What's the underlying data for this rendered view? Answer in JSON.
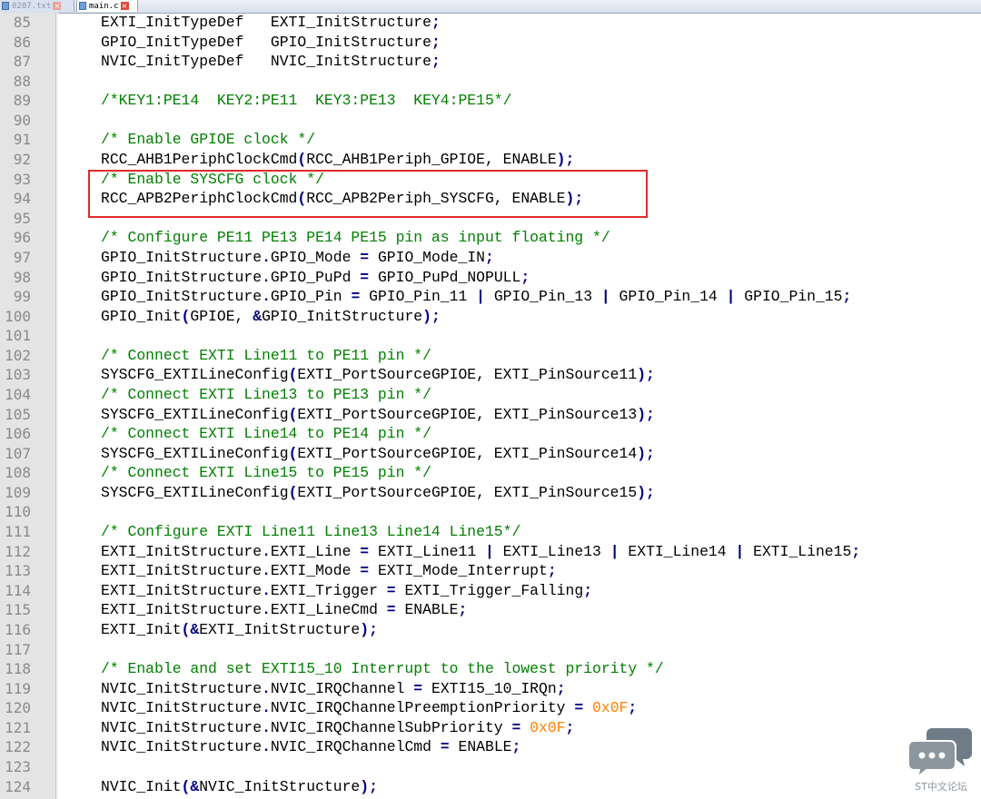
{
  "tabs": [
    {
      "label": "0207.txt",
      "active": false
    },
    {
      "label": "main.c",
      "active": true
    }
  ],
  "editor": {
    "lines": [
      {
        "num": "85",
        "tokens": [
          [
            "t",
            "EXTI_InitTypeDef   EXTI_InitStructure"
          ],
          [
            "o",
            ";"
          ]
        ]
      },
      {
        "num": "86",
        "tokens": [
          [
            "t",
            "GPIO_InitTypeDef   GPIO_InitStructure"
          ],
          [
            "o",
            ";"
          ]
        ]
      },
      {
        "num": "87",
        "tokens": [
          [
            "t",
            "NVIC_InitTypeDef   NVIC_InitStructure"
          ],
          [
            "o",
            ";"
          ]
        ]
      },
      {
        "num": "88",
        "tokens": []
      },
      {
        "num": "89",
        "tokens": [
          [
            "c",
            "/*KEY1:PE14  KEY2:PE11  KEY3:PE13  KEY4:PE15*/"
          ]
        ]
      },
      {
        "num": "90",
        "tokens": []
      },
      {
        "num": "91",
        "tokens": [
          [
            "c",
            "/* Enable GPIOE clock */"
          ]
        ]
      },
      {
        "num": "92",
        "tokens": [
          [
            "t",
            "RCC_AHB1PeriphClockCmd"
          ],
          [
            "o",
            "("
          ],
          [
            "t",
            "RCC_AHB1Periph_GPIOE, ENABLE"
          ],
          [
            "o",
            ");"
          ]
        ]
      },
      {
        "num": "93",
        "tokens": [
          [
            "c",
            "/* Enable SYSCFG clock */"
          ]
        ]
      },
      {
        "num": "94",
        "tokens": [
          [
            "t",
            "RCC_APB2PeriphClockCmd"
          ],
          [
            "o",
            "("
          ],
          [
            "t",
            "RCC_APB2Periph_SYSCFG, ENABLE"
          ],
          [
            "o",
            ");"
          ]
        ]
      },
      {
        "num": "95",
        "tokens": []
      },
      {
        "num": "96",
        "tokens": [
          [
            "c",
            "/* Configure PE11 PE13 PE14 PE15 pin as input floating */"
          ]
        ]
      },
      {
        "num": "97",
        "tokens": [
          [
            "t",
            "GPIO_InitStructure"
          ],
          [
            "o",
            "."
          ],
          [
            "t",
            "GPIO_Mode "
          ],
          [
            "o",
            "="
          ],
          [
            "t",
            " GPIO_Mode_IN"
          ],
          [
            "o",
            ";"
          ]
        ]
      },
      {
        "num": "98",
        "tokens": [
          [
            "t",
            "GPIO_InitStructure"
          ],
          [
            "o",
            "."
          ],
          [
            "t",
            "GPIO_PuPd "
          ],
          [
            "o",
            "="
          ],
          [
            "t",
            " GPIO_PuPd_NOPULL"
          ],
          [
            "o",
            ";"
          ]
        ]
      },
      {
        "num": "99",
        "tokens": [
          [
            "t",
            "GPIO_InitStructure"
          ],
          [
            "o",
            "."
          ],
          [
            "t",
            "GPIO_Pin "
          ],
          [
            "o",
            "="
          ],
          [
            "t",
            " GPIO_Pin_11 "
          ],
          [
            "o",
            "|"
          ],
          [
            "t",
            " GPIO_Pin_13 "
          ],
          [
            "o",
            "|"
          ],
          [
            "t",
            " GPIO_Pin_14 "
          ],
          [
            "o",
            "|"
          ],
          [
            "t",
            " GPIO_Pin_15"
          ],
          [
            "o",
            ";"
          ]
        ]
      },
      {
        "num": "100",
        "tokens": [
          [
            "t",
            "GPIO_Init"
          ],
          [
            "o",
            "("
          ],
          [
            "t",
            "GPIOE, "
          ],
          [
            "o",
            "&"
          ],
          [
            "t",
            "GPIO_InitStructure"
          ],
          [
            "o",
            ");"
          ]
        ]
      },
      {
        "num": "101",
        "tokens": []
      },
      {
        "num": "102",
        "tokens": [
          [
            "c",
            "/* Connect EXTI Line11 to PE11 pin */"
          ]
        ]
      },
      {
        "num": "103",
        "tokens": [
          [
            "t",
            "SYSCFG_EXTILineConfig"
          ],
          [
            "o",
            "("
          ],
          [
            "t",
            "EXTI_PortSourceGPIOE, EXTI_PinSource11"
          ],
          [
            "o",
            ");"
          ]
        ]
      },
      {
        "num": "104",
        "tokens": [
          [
            "c",
            "/* Connect EXTI Line13 to PE13 pin */"
          ]
        ]
      },
      {
        "num": "105",
        "tokens": [
          [
            "t",
            "SYSCFG_EXTILineConfig"
          ],
          [
            "o",
            "("
          ],
          [
            "t",
            "EXTI_PortSourceGPIOE, EXTI_PinSource13"
          ],
          [
            "o",
            ");"
          ]
        ]
      },
      {
        "num": "106",
        "tokens": [
          [
            "c",
            "/* Connect EXTI Line14 to PE14 pin */"
          ]
        ]
      },
      {
        "num": "107",
        "tokens": [
          [
            "t",
            "SYSCFG_EXTILineConfig"
          ],
          [
            "o",
            "("
          ],
          [
            "t",
            "EXTI_PortSourceGPIOE, EXTI_PinSource14"
          ],
          [
            "o",
            ");"
          ]
        ]
      },
      {
        "num": "108",
        "tokens": [
          [
            "c",
            "/* Connect EXTI Line15 to PE15 pin */"
          ]
        ]
      },
      {
        "num": "109",
        "tokens": [
          [
            "t",
            "SYSCFG_EXTILineConfig"
          ],
          [
            "o",
            "("
          ],
          [
            "t",
            "EXTI_PortSourceGPIOE, EXTI_PinSource15"
          ],
          [
            "o",
            ");"
          ]
        ]
      },
      {
        "num": "110",
        "tokens": []
      },
      {
        "num": "111",
        "tokens": [
          [
            "c",
            "/* Configure EXTI Line11 Line13 Line14 Line15*/"
          ]
        ]
      },
      {
        "num": "112",
        "tokens": [
          [
            "t",
            "EXTI_InitStructure"
          ],
          [
            "o",
            "."
          ],
          [
            "t",
            "EXTI_Line "
          ],
          [
            "o",
            "="
          ],
          [
            "t",
            " EXTI_Line11 "
          ],
          [
            "o",
            "|"
          ],
          [
            "t",
            " EXTI_Line13 "
          ],
          [
            "o",
            "|"
          ],
          [
            "t",
            " EXTI_Line14 "
          ],
          [
            "o",
            "|"
          ],
          [
            "t",
            " EXTI_Line15"
          ],
          [
            "o",
            ";"
          ]
        ]
      },
      {
        "num": "113",
        "tokens": [
          [
            "t",
            "EXTI_InitStructure"
          ],
          [
            "o",
            "."
          ],
          [
            "t",
            "EXTI_Mode "
          ],
          [
            "o",
            "="
          ],
          [
            "t",
            " EXTI_Mode_Interrupt"
          ],
          [
            "o",
            ";"
          ]
        ]
      },
      {
        "num": "114",
        "tokens": [
          [
            "t",
            "EXTI_InitStructure"
          ],
          [
            "o",
            "."
          ],
          [
            "t",
            "EXTI_Trigger "
          ],
          [
            "o",
            "="
          ],
          [
            "t",
            " EXTI_Trigger_Falling"
          ],
          [
            "o",
            ";"
          ]
        ]
      },
      {
        "num": "115",
        "tokens": [
          [
            "t",
            "EXTI_InitStructure"
          ],
          [
            "o",
            "."
          ],
          [
            "t",
            "EXTI_LineCmd "
          ],
          [
            "o",
            "="
          ],
          [
            "t",
            " ENABLE"
          ],
          [
            "o",
            ";"
          ]
        ]
      },
      {
        "num": "116",
        "tokens": [
          [
            "t",
            "EXTI_Init"
          ],
          [
            "o",
            "(&"
          ],
          [
            "t",
            "EXTI_InitStructure"
          ],
          [
            "o",
            ");"
          ]
        ]
      },
      {
        "num": "117",
        "tokens": []
      },
      {
        "num": "118",
        "tokens": [
          [
            "c",
            "/* Enable and set EXTI15_10 Interrupt to the lowest priority */"
          ]
        ]
      },
      {
        "num": "119",
        "tokens": [
          [
            "t",
            "NVIC_InitStructure"
          ],
          [
            "o",
            "."
          ],
          [
            "t",
            "NVIC_IRQChannel "
          ],
          [
            "o",
            "="
          ],
          [
            "t",
            " EXTI15_10_IRQn"
          ],
          [
            "o",
            ";"
          ]
        ]
      },
      {
        "num": "120",
        "tokens": [
          [
            "t",
            "NVIC_InitStructure"
          ],
          [
            "o",
            "."
          ],
          [
            "t",
            "NVIC_IRQChannelPreemptionPriority "
          ],
          [
            "o",
            "="
          ],
          [
            "t",
            " "
          ],
          [
            "n",
            "0x0F"
          ],
          [
            "o",
            ";"
          ]
        ]
      },
      {
        "num": "121",
        "tokens": [
          [
            "t",
            "NVIC_InitStructure"
          ],
          [
            "o",
            "."
          ],
          [
            "t",
            "NVIC_IRQChannelSubPriority "
          ],
          [
            "o",
            "="
          ],
          [
            "t",
            " "
          ],
          [
            "n",
            "0x0F"
          ],
          [
            "o",
            ";"
          ]
        ]
      },
      {
        "num": "122",
        "tokens": [
          [
            "t",
            "NVIC_InitStructure"
          ],
          [
            "o",
            "."
          ],
          [
            "t",
            "NVIC_IRQChannelCmd "
          ],
          [
            "o",
            "="
          ],
          [
            "t",
            " ENABLE"
          ],
          [
            "o",
            ";"
          ]
        ]
      },
      {
        "num": "123",
        "tokens": []
      },
      {
        "num": "124",
        "tokens": [
          [
            "t",
            "NVIC_Init"
          ],
          [
            "o",
            "(&"
          ],
          [
            "t",
            "NVIC_InitStructure"
          ],
          [
            "o",
            ");"
          ]
        ]
      }
    ]
  },
  "watermark": {
    "label": "ST中文论坛",
    "icon": "chat-bubbles-icon"
  },
  "colors": {
    "comment": "#008000",
    "operator": "#000080",
    "number": "#ff8000",
    "highlight_box": "#e02b2b",
    "watermark": "#8c96a0"
  }
}
